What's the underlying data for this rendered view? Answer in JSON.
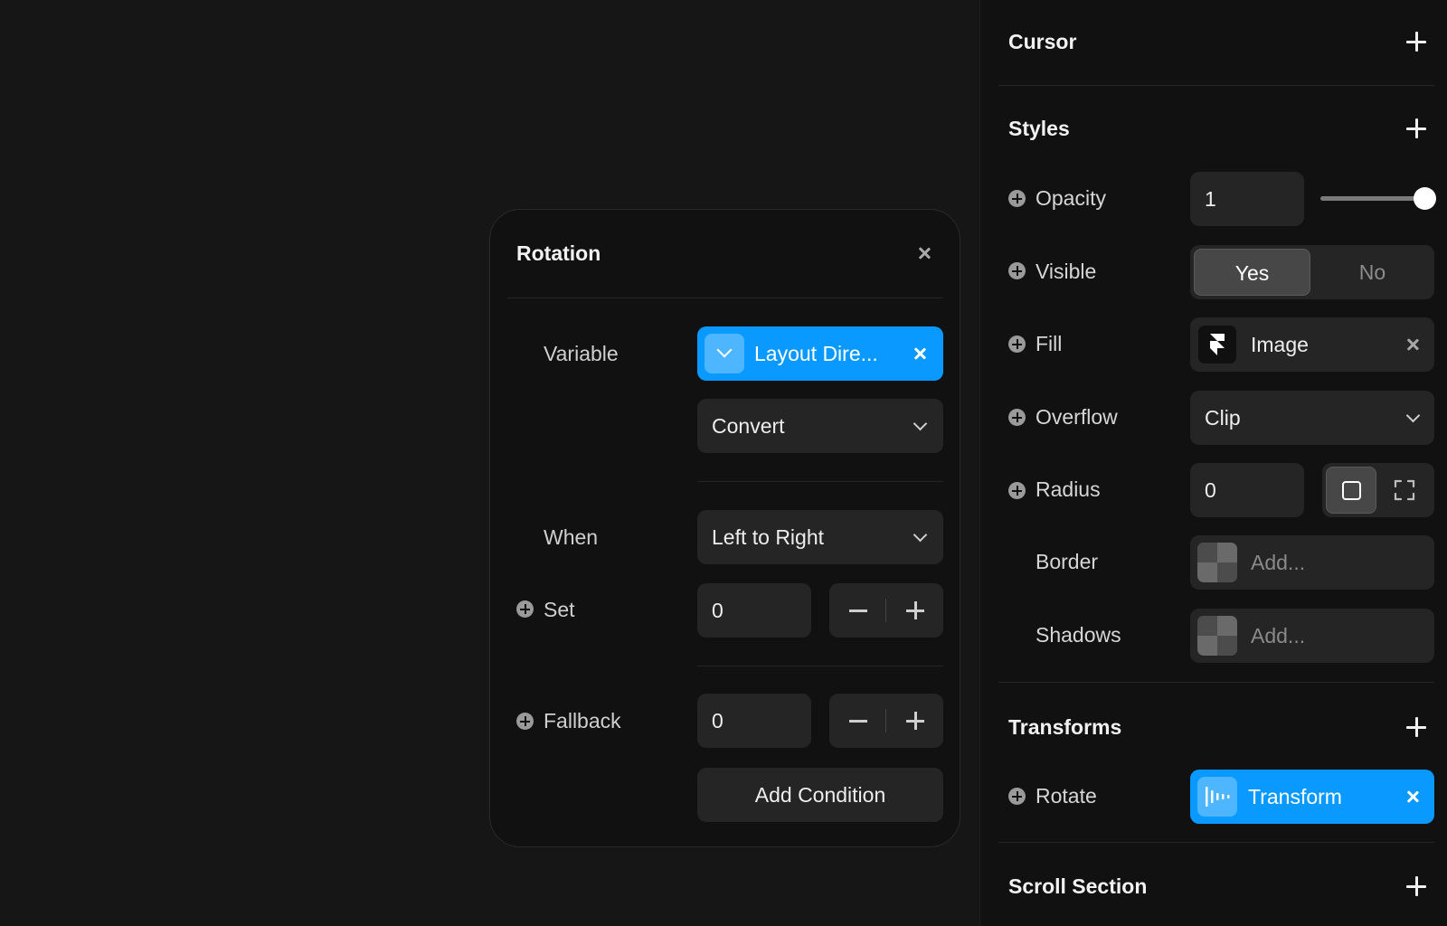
{
  "panel": {
    "sections": {
      "cursor": "Cursor",
      "styles": "Styles",
      "transforms": "Transforms",
      "scroll_section": "Scroll Section"
    },
    "opacity": {
      "label": "Opacity",
      "value": "1",
      "slider_fraction": 1.0
    },
    "visible": {
      "label": "Visible",
      "yes": "Yes",
      "no": "No",
      "selected": "Yes"
    },
    "fill": {
      "label": "Fill",
      "value": "Image",
      "icon": "framer-logo-icon"
    },
    "overflow": {
      "label": "Overflow",
      "value": "Clip"
    },
    "radius": {
      "label": "Radius",
      "value": "0",
      "mode": "uniform"
    },
    "border": {
      "label": "Border",
      "placeholder": "Add..."
    },
    "shadows": {
      "label": "Shadows",
      "placeholder": "Add..."
    },
    "rotate": {
      "label": "Rotate",
      "value": "Transform",
      "icon": "transform-bars-icon",
      "accent": "#0a99ff"
    }
  },
  "popup": {
    "title": "Rotation",
    "variable": {
      "label": "Variable",
      "value": "Layout Dire...",
      "accent": "#0a99ff"
    },
    "convert": {
      "value": "Convert"
    },
    "when": {
      "label": "When",
      "value": "Left to Right"
    },
    "set": {
      "label": "Set",
      "value": "0"
    },
    "fallback": {
      "label": "Fallback",
      "value": "0"
    },
    "add_condition": "Add Condition"
  }
}
